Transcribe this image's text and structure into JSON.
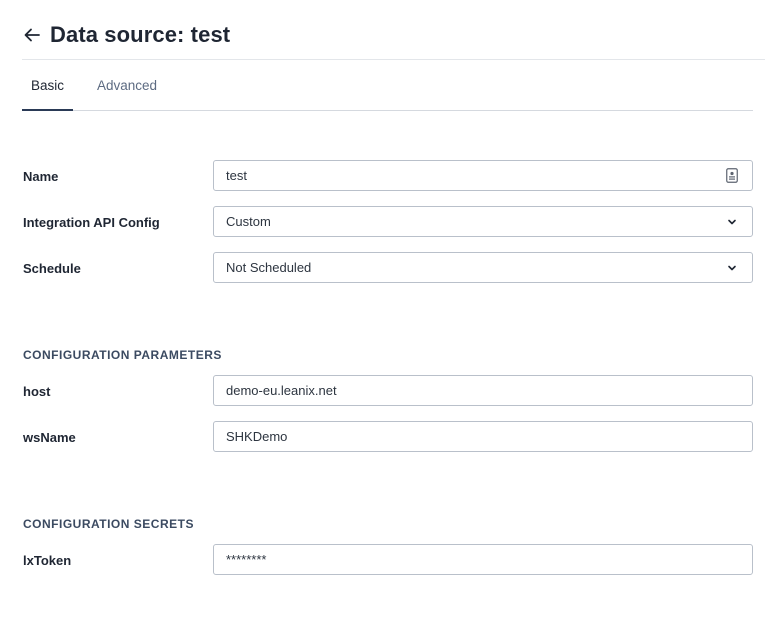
{
  "header": {
    "title": "Data source: test",
    "back_icon": "arrow-left-icon"
  },
  "tabs": [
    {
      "label": "Basic",
      "active": true
    },
    {
      "label": "Advanced",
      "active": false
    }
  ],
  "basic": {
    "name": {
      "label": "Name",
      "value": "test",
      "suffix_icon": "contact-card-icon"
    },
    "integration_api_config": {
      "label": "Integration API Config",
      "value": "Custom",
      "icon": "chevron-down-icon"
    },
    "schedule": {
      "label": "Schedule",
      "value": "Not Scheduled",
      "icon": "chevron-down-icon"
    }
  },
  "configuration_parameters": {
    "heading": "CONFIGURATION PARAMETERS",
    "host": {
      "label": "host",
      "value": "demo-eu.leanix.net"
    },
    "wsName": {
      "label": "wsName",
      "value": "SHKDemo"
    }
  },
  "configuration_secrets": {
    "heading": "CONFIGURATION SECRETS",
    "lxToken": {
      "label": "lxToken",
      "value": "********"
    }
  },
  "colors": {
    "text": "#1f2633",
    "border": "#b9c0ca",
    "tab_indicator": "#2a3a56",
    "muted": "#5d6b82"
  }
}
